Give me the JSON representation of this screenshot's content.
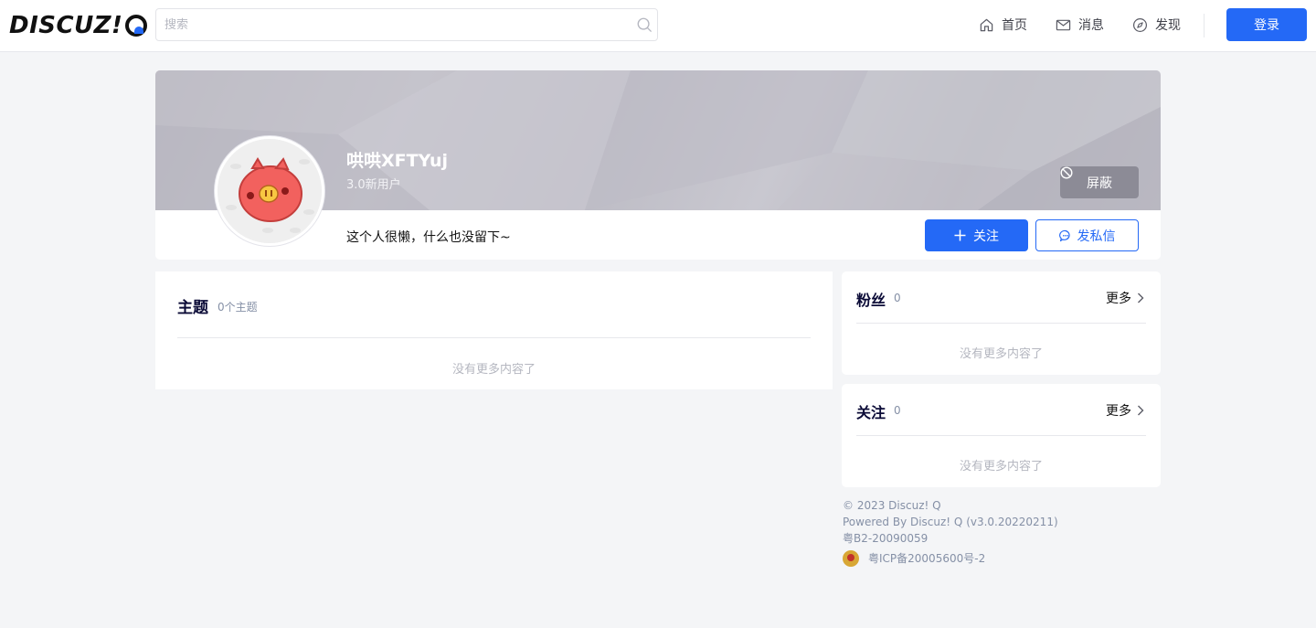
{
  "header": {
    "logo_text": "DISCUZ!",
    "search_placeholder": "搜索",
    "nav": [
      {
        "label": "首页",
        "icon": "home-icon"
      },
      {
        "label": "消息",
        "icon": "mail-icon"
      },
      {
        "label": "发现",
        "icon": "compass-icon"
      }
    ],
    "login_label": "登录"
  },
  "profile": {
    "username": "哄哄XFTYuj",
    "usergroup": "3.0新用户",
    "signature": "这个人很懒，什么也没留下~",
    "block_label": "屏蔽",
    "follow_label": "关注",
    "message_label": "发私信",
    "avatar": "pig-avatar"
  },
  "threads": {
    "title": "主题",
    "count": "0个主题",
    "empty_text": "没有更多内容了"
  },
  "fans": {
    "title": "粉丝",
    "count": "0",
    "more_label": "更多",
    "empty_text": "没有更多内容了"
  },
  "following": {
    "title": "关注",
    "count": "0",
    "more_label": "更多",
    "empty_text": "没有更多内容了"
  },
  "footer": {
    "copyright": "© 2023 Discuz! Q",
    "powered": "Powered By Discuz! Q (v3.0.20220211)",
    "license": "粤B2-20090059",
    "icp": "粤ICP备20005600号-2"
  },
  "colors": {
    "primary": "#2469f6",
    "block_button": "#8c8b96",
    "page_background": "#f4f5f7"
  }
}
